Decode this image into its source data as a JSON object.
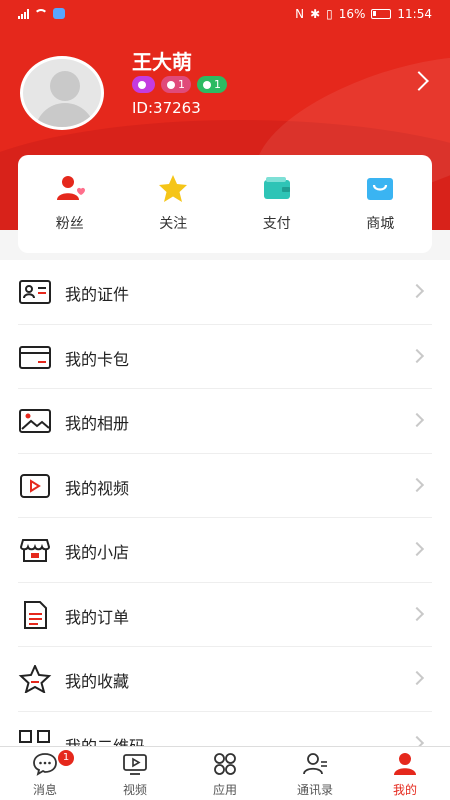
{
  "status_bar": {
    "time": "11:54",
    "battery": "16%"
  },
  "profile": {
    "name": "王大萌",
    "id": "ID:37263",
    "badges": [
      {
        "value": ""
      },
      {
        "value": "1"
      },
      {
        "value": "1"
      }
    ]
  },
  "quick_actions": [
    {
      "label": "粉丝",
      "icon": "fans-icon"
    },
    {
      "label": "关注",
      "icon": "star-icon"
    },
    {
      "label": "支付",
      "icon": "wallet-icon"
    },
    {
      "label": "商城",
      "icon": "shopping-bag-icon"
    }
  ],
  "menu": [
    {
      "label": "我的证件",
      "icon": "id-card-icon"
    },
    {
      "label": "我的卡包",
      "icon": "card-wallet-icon"
    },
    {
      "label": "我的相册",
      "icon": "photo-album-icon"
    },
    {
      "label": "我的视频",
      "icon": "video-icon"
    },
    {
      "label": "我的小店",
      "icon": "store-icon"
    },
    {
      "label": "我的订单",
      "icon": "order-icon"
    },
    {
      "label": "我的收藏",
      "icon": "favorite-star-icon"
    },
    {
      "label": "我的二维码",
      "icon": "qr-code-icon"
    }
  ],
  "tabs": [
    {
      "label": "消息",
      "badge": "1"
    },
    {
      "label": "视频"
    },
    {
      "label": "应用"
    },
    {
      "label": "通讯录"
    },
    {
      "label": "我的"
    }
  ],
  "colors": {
    "primary": "#e5281c",
    "accent_pink": "#e04a7a",
    "accent_teal": "#2ec4b6",
    "accent_blue": "#3ab4f2",
    "accent_yellow": "#f5c518"
  }
}
